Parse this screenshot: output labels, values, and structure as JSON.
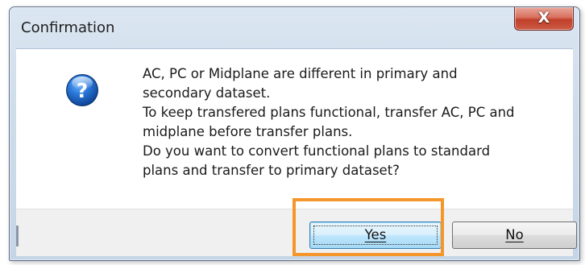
{
  "dialog": {
    "title": "Confirmation",
    "close_label": "X",
    "icon": "question-icon",
    "message_lines": [
      "AC, PC or Midplane are different in primary and",
      "secondary dataset.",
      "To keep transfered plans functional, transfer AC, PC and",
      "midplane before transfer plans.",
      "Do you want to convert functional plans to standard",
      "plans and transfer to primary dataset?"
    ],
    "buttons": {
      "yes_label": "Yes",
      "no_label": "No",
      "default": "yes"
    },
    "highlight": {
      "target": "yes-button",
      "color": "#f5962b"
    }
  },
  "colors": {
    "close_button": "#c0402a",
    "icon_blue": "#1b5fb8",
    "highlight": "#f5962b"
  }
}
